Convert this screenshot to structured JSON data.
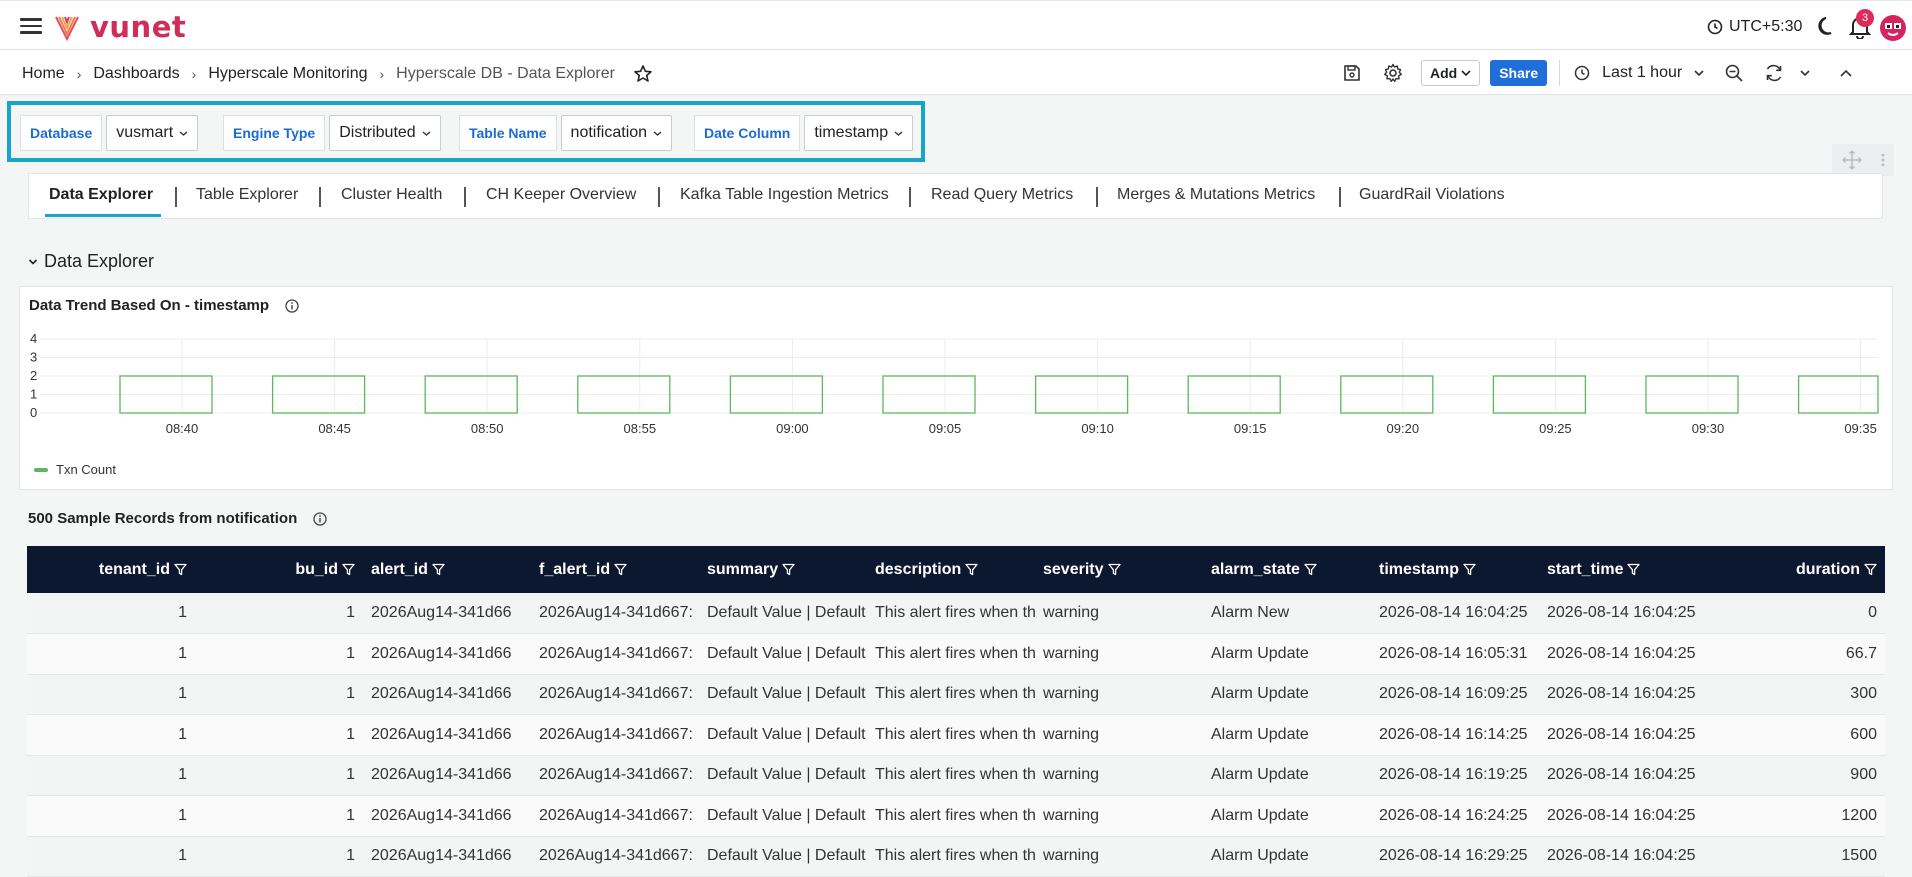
{
  "app": {
    "brand": "vunet",
    "timezone": "UTC+5:30",
    "notification_count": "3"
  },
  "breadcrumb": [
    "Home",
    "Dashboards",
    "Hyperscale Monitoring",
    "Hyperscale DB - Data Explorer"
  ],
  "toolbar": {
    "add_label": "Add",
    "share_label": "Share",
    "time_range": "Last 1 hour"
  },
  "filters": [
    {
      "label": "Database",
      "value": "vusmart"
    },
    {
      "label": "Engine Type",
      "value": "Distributed"
    },
    {
      "label": "Table Name",
      "value": "notification"
    },
    {
      "label": "Date Column",
      "value": "timestamp"
    }
  ],
  "tabs": [
    "Data Explorer",
    "Table Explorer",
    "Cluster Health",
    "CH Keeper Overview",
    "Kafka Table Ingestion Metrics",
    "Read Query Metrics",
    "Merges & Mutations Metrics",
    "GuardRail Violations"
  ],
  "section": {
    "title": "Data Explorer"
  },
  "chart_panel": {
    "title": "Data Trend Based On - timestamp"
  },
  "chart_data": {
    "type": "bar",
    "title": "Data Trend Based On - timestamp",
    "xlabel": "",
    "ylabel": "",
    "ylim": [
      0,
      4
    ],
    "yticks": [
      "4",
      "3",
      "2",
      "1",
      "0"
    ],
    "xticks": [
      "08:40",
      "08:45",
      "08:50",
      "08:55",
      "09:00",
      "09:05",
      "09:10",
      "09:15",
      "09:20",
      "09:25",
      "09:30",
      "09:35"
    ],
    "series": [
      {
        "name": "Txn Count",
        "color": "#5cb85c",
        "values": [
          2,
          2,
          2,
          2,
          2,
          2,
          2,
          2,
          2,
          2,
          2,
          2
        ]
      }
    ],
    "grid": true,
    "legend": "bottom-left"
  },
  "table": {
    "title": "500 Sample Records from notification",
    "columns": [
      "tenant_id",
      "bu_id",
      "alert_id",
      "f_alert_id",
      "summary",
      "description",
      "severity",
      "alarm_state",
      "timestamp",
      "start_time",
      "duration"
    ],
    "rows": [
      [
        "1",
        "1",
        "2026Aug14-341d66",
        "2026Aug14-341d667:",
        "Default Value | Default",
        "This alert fires when th",
        "warning",
        "Alarm New",
        "2026-08-14 16:04:25",
        "2026-08-14 16:04:25",
        "0"
      ],
      [
        "1",
        "1",
        "2026Aug14-341d66",
        "2026Aug14-341d667:",
        "Default Value | Default",
        "This alert fires when th",
        "warning",
        "Alarm Update",
        "2026-08-14 16:05:31",
        "2026-08-14 16:04:25",
        "66.7"
      ],
      [
        "1",
        "1",
        "2026Aug14-341d66",
        "2026Aug14-341d667:",
        "Default Value | Default",
        "This alert fires when th",
        "warning",
        "Alarm Update",
        "2026-08-14 16:09:25",
        "2026-08-14 16:04:25",
        "300"
      ],
      [
        "1",
        "1",
        "2026Aug14-341d66",
        "2026Aug14-341d667:",
        "Default Value | Default",
        "This alert fires when th",
        "warning",
        "Alarm Update",
        "2026-08-14 16:14:25",
        "2026-08-14 16:04:25",
        "600"
      ],
      [
        "1",
        "1",
        "2026Aug14-341d66",
        "2026Aug14-341d667:",
        "Default Value | Default",
        "This alert fires when th",
        "warning",
        "Alarm Update",
        "2026-08-14 16:19:25",
        "2026-08-14 16:04:25",
        "900"
      ],
      [
        "1",
        "1",
        "2026Aug14-341d66",
        "2026Aug14-341d667:",
        "Default Value | Default",
        "This alert fires when th",
        "warning",
        "Alarm Update",
        "2026-08-14 16:24:25",
        "2026-08-14 16:04:25",
        "1200"
      ],
      [
        "1",
        "1",
        "2026Aug14-341d66",
        "2026Aug14-341d667:",
        "Default Value | Default",
        "This alert fires when th",
        "warning",
        "Alarm Update",
        "2026-08-14 16:29:25",
        "2026-08-14 16:04:25",
        "1500"
      ]
    ]
  },
  "colors": {
    "accent": "#17a6c8",
    "brand": "#cf2e5a",
    "primary_button": "#1e6fd9",
    "table_header": "#0c1730"
  }
}
